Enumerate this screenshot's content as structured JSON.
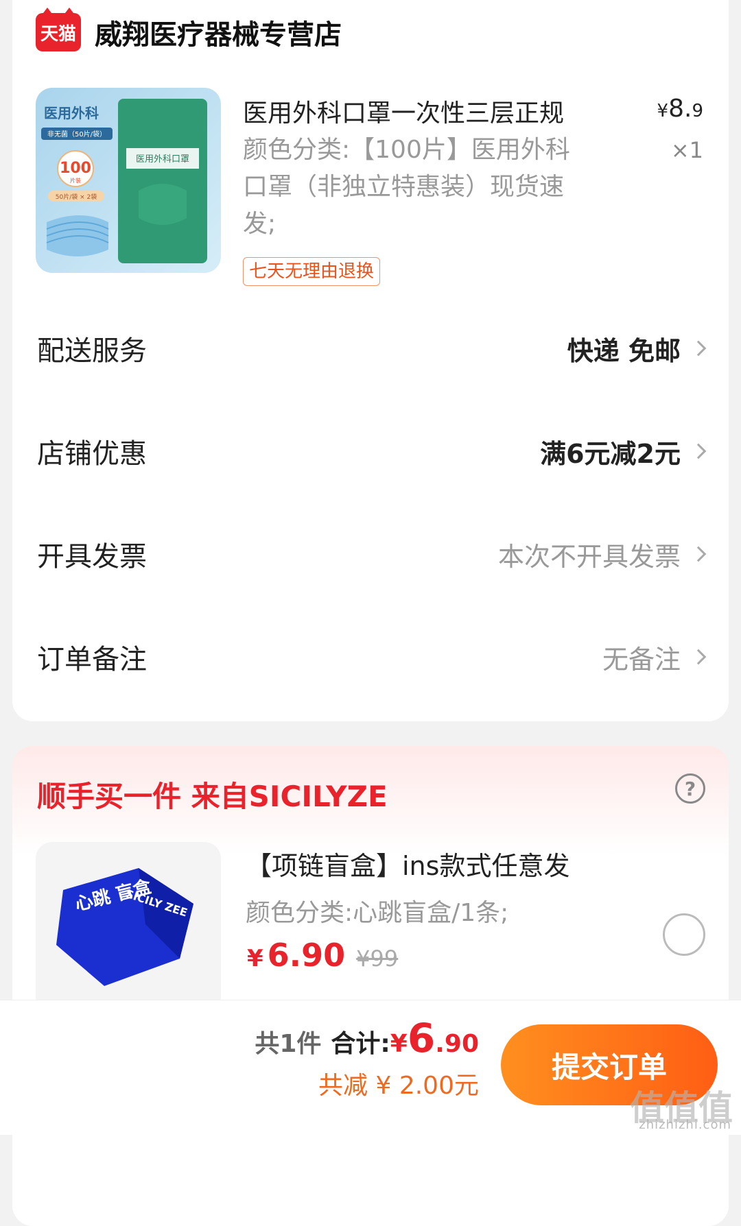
{
  "shop": {
    "logo_text": "天猫",
    "name": "威翔医疗器械专营店"
  },
  "product": {
    "title": "医用外科口罩一次性三层正规",
    "spec": "颜色分类:【100片】医用外科口罩（非独立特惠装）现货速发;",
    "price_currency": "¥",
    "price_int": "8.",
    "price_dec": "9",
    "quantity": "×1",
    "badge": "七天无理由退换",
    "image_text": {
      "line1": "医用外科",
      "line2": "非无菌（50片/袋）",
      "count": "100",
      "count_unit": "片装",
      "pack": "50片/袋 × 2袋",
      "bag_label": "医用外科口罩"
    }
  },
  "rows": [
    {
      "label": "配送服务",
      "value": "快递 免邮"
    },
    {
      "label": "店铺优惠",
      "value": "满6元减2元"
    },
    {
      "label": "开具发票",
      "value": "本次不开具发票"
    },
    {
      "label": "订单备注",
      "value": "无备注"
    }
  ],
  "promo": {
    "title": "顺手买一件  来自SICILYZE",
    "help": "?",
    "item_title": "【项链盲盒】ins款式任意发",
    "item_spec": "颜色分类:心跳盲盒/1条;",
    "price_currency": "¥",
    "price": "6.90",
    "old_price": "¥99",
    "image_text": {
      "brand": "SICILY ZEE",
      "label": "心跳 盲盒"
    }
  },
  "footer": {
    "count": "共1件",
    "sum_label": "合计:",
    "sum_currency": "¥",
    "sum_int": "6",
    "sum_dec": ".90",
    "discount": "共减 ¥ 2.00元",
    "submit": "提交订单"
  },
  "watermark": {
    "text": "值值值",
    "sub": "zhizhizhi.com"
  },
  "colors": {
    "brand_red": "#e8232b",
    "accent_orange": "#ff6a14"
  }
}
